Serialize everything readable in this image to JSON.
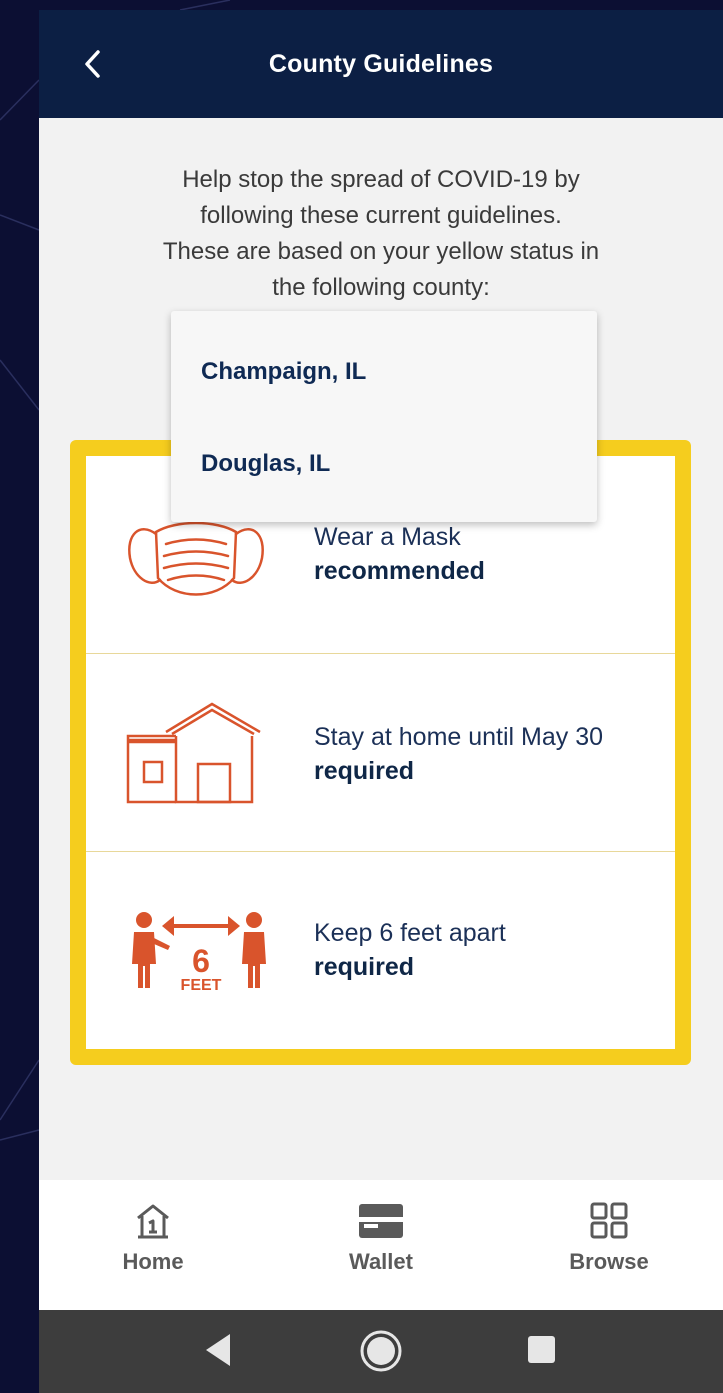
{
  "header": {
    "title": "County Guidelines",
    "back_icon": "chevron-left-icon"
  },
  "intro": {
    "line1": "Help stop the spread of COVID-19 by",
    "line2": "following these current guidelines.",
    "line3": "These are based on your yellow status in",
    "line4": "the following county:"
  },
  "county_dropdown": {
    "options": [
      {
        "label": "Champaign, IL"
      },
      {
        "label": "Douglas, IL"
      }
    ]
  },
  "status_color": "#f5cd1e",
  "accent_color": "#d9542c",
  "guidelines": [
    {
      "icon": "face-mask-icon",
      "label": "Wear a Mask",
      "status": "recommended"
    },
    {
      "icon": "house-icon",
      "label": "Stay at home until May 30",
      "status": "required"
    },
    {
      "icon": "social-distance-icon",
      "label": "Keep 6 feet apart",
      "status": "required",
      "icon_text": "6",
      "icon_subtext": "FEET"
    }
  ],
  "tabbar": {
    "items": [
      {
        "label": "Home",
        "icon": "home-icon"
      },
      {
        "label": "Wallet",
        "icon": "wallet-icon"
      },
      {
        "label": "Browse",
        "icon": "grid-icon"
      }
    ]
  },
  "system_nav": {
    "buttons": [
      "back-triangle-icon",
      "home-circle-icon",
      "recents-square-icon"
    ]
  }
}
